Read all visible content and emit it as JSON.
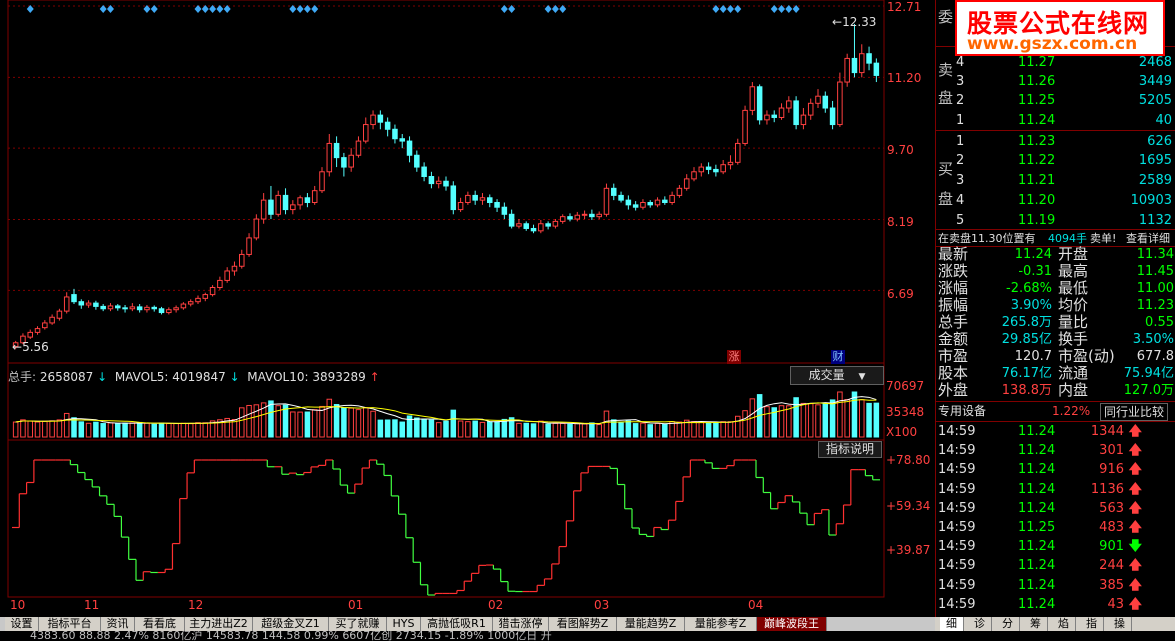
{
  "price_chart": {
    "y_ticks": [
      "12.71",
      "11.20",
      "9.70",
      "8.19",
      "6.69"
    ],
    "high_label": "12.33",
    "low_label": "5.56",
    "event_markers": [
      "涨",
      "财"
    ],
    "candles": [
      [
        5.5,
        5.58,
        5.45,
        5.62
      ],
      [
        5.58,
        5.72,
        5.55,
        5.78
      ],
      [
        5.7,
        5.8,
        5.66,
        5.86
      ],
      [
        5.8,
        5.88,
        5.75,
        5.93
      ],
      [
        5.9,
        6.0,
        5.86,
        6.06
      ],
      [
        6.0,
        6.12,
        5.96,
        6.18
      ],
      [
        6.1,
        6.25,
        6.05,
        6.3
      ],
      [
        6.25,
        6.55,
        6.2,
        6.65
      ],
      [
        6.6,
        6.45,
        6.4,
        6.72
      ],
      [
        6.45,
        6.38,
        6.3,
        6.5
      ],
      [
        6.38,
        6.42,
        6.32,
        6.48
      ],
      [
        6.42,
        6.35,
        6.28,
        6.47
      ],
      [
        6.35,
        6.3,
        6.25,
        6.4
      ],
      [
        6.3,
        6.36,
        6.25,
        6.42
      ],
      [
        6.36,
        6.32,
        6.26,
        6.4
      ],
      [
        6.32,
        6.3,
        6.22,
        6.38
      ],
      [
        6.3,
        6.34,
        6.25,
        6.42
      ],
      [
        6.34,
        6.28,
        6.22,
        6.4
      ],
      [
        6.28,
        6.33,
        6.22,
        6.38
      ],
      [
        6.33,
        6.3,
        6.24,
        6.37
      ],
      [
        6.3,
        6.22,
        6.18,
        6.34
      ],
      [
        6.22,
        6.28,
        6.18,
        6.33
      ],
      [
        6.28,
        6.32,
        6.22,
        6.37
      ],
      [
        6.32,
        6.4,
        6.28,
        6.44
      ],
      [
        6.4,
        6.45,
        6.35,
        6.5
      ],
      [
        6.45,
        6.52,
        6.4,
        6.58
      ],
      [
        6.52,
        6.6,
        6.46,
        6.64
      ],
      [
        6.6,
        6.75,
        6.56,
        6.8
      ],
      [
        6.75,
        6.9,
        6.7,
        6.98
      ],
      [
        6.9,
        7.1,
        6.85,
        7.18
      ],
      [
        7.1,
        7.2,
        7.0,
        7.3
      ],
      [
        7.2,
        7.45,
        7.15,
        7.55
      ],
      [
        7.45,
        7.8,
        7.4,
        7.9
      ],
      [
        7.8,
        8.2,
        7.75,
        8.3
      ],
      [
        8.2,
        8.6,
        8.1,
        8.75
      ],
      [
        8.6,
        8.3,
        8.2,
        8.9
      ],
      [
        8.3,
        8.7,
        8.25,
        8.8
      ],
      [
        8.7,
        8.4,
        8.3,
        8.85
      ],
      [
        8.4,
        8.5,
        8.3,
        8.6
      ],
      [
        8.5,
        8.65,
        8.4,
        8.7
      ],
      [
        8.65,
        8.55,
        8.45,
        8.75
      ],
      [
        8.55,
        8.8,
        8.5,
        8.9
      ],
      [
        8.8,
        9.2,
        8.75,
        9.3
      ],
      [
        9.2,
        9.8,
        9.1,
        10.0
      ],
      [
        9.8,
        9.5,
        9.3,
        9.95
      ],
      [
        9.5,
        9.3,
        9.1,
        9.6
      ],
      [
        9.3,
        9.55,
        9.2,
        9.7
      ],
      [
        9.55,
        9.85,
        9.5,
        9.95
      ],
      [
        9.85,
        10.2,
        9.8,
        10.35
      ],
      [
        10.2,
        10.4,
        10.1,
        10.5
      ],
      [
        10.4,
        10.25,
        10.1,
        10.5
      ],
      [
        10.25,
        10.1,
        9.95,
        10.35
      ],
      [
        10.1,
        9.9,
        9.8,
        10.2
      ],
      [
        9.9,
        9.85,
        9.7,
        10.0
      ],
      [
        9.85,
        9.55,
        9.4,
        9.95
      ],
      [
        9.55,
        9.3,
        9.2,
        9.65
      ],
      [
        9.3,
        9.1,
        9.0,
        9.4
      ],
      [
        9.1,
        8.95,
        8.85,
        9.2
      ],
      [
        8.95,
        9.0,
        8.85,
        9.1
      ],
      [
        9.0,
        8.9,
        8.8,
        9.1
      ],
      [
        8.9,
        8.4,
        8.3,
        9.0
      ],
      [
        8.4,
        8.55,
        8.35,
        8.65
      ],
      [
        8.55,
        8.7,
        8.5,
        8.78
      ],
      [
        8.7,
        8.6,
        8.5,
        8.8
      ],
      [
        8.6,
        8.65,
        8.5,
        8.75
      ],
      [
        8.65,
        8.55,
        8.45,
        8.72
      ],
      [
        8.55,
        8.45,
        8.35,
        8.62
      ],
      [
        8.45,
        8.3,
        8.2,
        8.55
      ],
      [
        8.3,
        8.05,
        8.0,
        8.4
      ],
      [
        8.05,
        8.1,
        8.0,
        8.2
      ],
      [
        8.1,
        8.0,
        7.95,
        8.15
      ],
      [
        8.0,
        7.95,
        7.9,
        8.08
      ],
      [
        7.95,
        8.1,
        7.9,
        8.18
      ],
      [
        8.1,
        8.05,
        7.98,
        8.15
      ],
      [
        8.05,
        8.15,
        8.0,
        8.2
      ],
      [
        8.15,
        8.25,
        8.1,
        8.3
      ],
      [
        8.25,
        8.2,
        8.15,
        8.32
      ],
      [
        8.2,
        8.28,
        8.15,
        8.35
      ],
      [
        8.28,
        8.3,
        8.2,
        8.38
      ],
      [
        8.3,
        8.25,
        8.18,
        8.4
      ],
      [
        8.25,
        8.3,
        8.2,
        8.36
      ],
      [
        8.3,
        8.85,
        8.25,
        8.95
      ],
      [
        8.85,
        8.7,
        8.6,
        8.95
      ],
      [
        8.7,
        8.6,
        8.55,
        8.78
      ],
      [
        8.6,
        8.5,
        8.4,
        8.7
      ],
      [
        8.5,
        8.45,
        8.38,
        8.58
      ],
      [
        8.45,
        8.55,
        8.4,
        8.62
      ],
      [
        8.55,
        8.5,
        8.44,
        8.6
      ],
      [
        8.5,
        8.6,
        8.45,
        8.66
      ],
      [
        8.6,
        8.55,
        8.5,
        8.68
      ],
      [
        8.55,
        8.7,
        8.5,
        8.78
      ],
      [
        8.7,
        8.85,
        8.65,
        8.92
      ],
      [
        8.85,
        9.05,
        8.8,
        9.15
      ],
      [
        9.05,
        9.2,
        9.0,
        9.3
      ],
      [
        9.2,
        9.3,
        9.1,
        9.38
      ],
      [
        9.3,
        9.25,
        9.15,
        9.4
      ],
      [
        9.25,
        9.2,
        9.1,
        9.35
      ],
      [
        9.2,
        9.35,
        9.15,
        9.45
      ],
      [
        9.35,
        9.4,
        9.25,
        9.55
      ],
      [
        9.4,
        9.8,
        9.35,
        9.9
      ],
      [
        9.8,
        10.5,
        9.75,
        10.6
      ],
      [
        10.5,
        11.0,
        10.4,
        11.1
      ],
      [
        11.0,
        10.3,
        10.2,
        11.05
      ],
      [
        10.3,
        10.4,
        10.2,
        10.5
      ],
      [
        10.4,
        10.35,
        10.25,
        10.5
      ],
      [
        10.35,
        10.55,
        10.3,
        10.65
      ],
      [
        10.55,
        10.7,
        10.45,
        10.8
      ],
      [
        10.7,
        10.2,
        10.1,
        10.8
      ],
      [
        10.2,
        10.4,
        10.1,
        10.55
      ],
      [
        10.4,
        10.65,
        10.3,
        10.75
      ],
      [
        10.65,
        10.8,
        10.55,
        10.95
      ],
      [
        10.8,
        10.55,
        10.45,
        10.9
      ],
      [
        10.55,
        10.2,
        10.1,
        10.7
      ],
      [
        10.2,
        11.1,
        10.15,
        11.3
      ],
      [
        11.1,
        11.6,
        11.0,
        11.7
      ],
      [
        11.6,
        11.3,
        11.2,
        12.33
      ],
      [
        11.3,
        11.7,
        11.2,
        11.9
      ],
      [
        11.7,
        11.5,
        11.35,
        11.85
      ],
      [
        11.5,
        11.24,
        11.1,
        11.6
      ]
    ]
  },
  "volume_chart": {
    "summary": [
      {
        "label": "总手:",
        "value": "2658087",
        "dir": "down"
      },
      {
        "label": "MAVOL5:",
        "value": "4019847",
        "dir": "down"
      },
      {
        "label": "MAVOL10:",
        "value": "3893289",
        "dir": "up"
      }
    ],
    "dropdown_label": "成交量",
    "y_ticks": [
      "70697",
      "35348",
      "X100"
    ]
  },
  "indicator_chart": {
    "y_ticks": [
      "+78.80",
      "+59.34",
      "+39.87"
    ],
    "button_label": "指标说明"
  },
  "x_axis": {
    "labels": [
      {
        "text": "10",
        "index": 0
      },
      {
        "text": "11",
        "index": 12
      },
      {
        "text": "12",
        "index": 27
      },
      {
        "text": "01",
        "index": 50
      },
      {
        "text": "02",
        "index": 70
      },
      {
        "text": "03",
        "index": 86
      },
      {
        "text": "04",
        "index": 108
      }
    ]
  },
  "order_book": {
    "top_label": "委",
    "sell_label": [
      "卖",
      "盘"
    ],
    "buy_label": [
      "买",
      "盘"
    ],
    "sell": [
      {
        "level": "4",
        "price": "11.27",
        "vol": "2468"
      },
      {
        "level": "3",
        "price": "11.26",
        "vol": "3449"
      },
      {
        "level": "2",
        "price": "11.25",
        "vol": "5205"
      },
      {
        "level": "1",
        "price": "11.24",
        "vol": "40"
      }
    ],
    "buy": [
      {
        "level": "1",
        "price": "11.23",
        "vol": "626"
      },
      {
        "level": "2",
        "price": "11.22",
        "vol": "1695"
      },
      {
        "level": "3",
        "price": "11.21",
        "vol": "2589"
      },
      {
        "level": "4",
        "price": "11.20",
        "vol": "10903"
      },
      {
        "level": "5",
        "price": "11.19",
        "vol": "1132"
      }
    ],
    "notice": {
      "text": "在卖盘11.30位置有",
      "qty": "4094手",
      "action": "卖单!",
      "link": "查看详细"
    }
  },
  "quote": [
    {
      "l1": "最新",
      "v1": "11.24",
      "c1": "green",
      "l2": "开盘",
      "v2": "11.34",
      "c2": "green"
    },
    {
      "l1": "涨跌",
      "v1": "-0.31",
      "c1": "green",
      "l2": "最高",
      "v2": "11.45",
      "c2": "green"
    },
    {
      "l1": "涨幅",
      "v1": "-2.68%",
      "c1": "green",
      "l2": "最低",
      "v2": "11.00",
      "c2": "green"
    },
    {
      "l1": "振幅",
      "v1": "3.90%",
      "c1": "cyan",
      "l2": "均价",
      "v2": "11.23",
      "c2": "green"
    },
    {
      "l1": "总手",
      "v1": "265.8万",
      "c1": "cyan",
      "l2": "量比",
      "v2": "0.55",
      "c2": "green"
    },
    {
      "l1": "金额",
      "v1": "29.85亿",
      "c1": "cyan",
      "l2": "换手",
      "v2": "3.50%",
      "c2": "cyan"
    },
    {
      "l1": "市盈",
      "v1": "120.7",
      "c1": "white",
      "l2": "市盈(动)",
      "v2": "677.8",
      "c2": "white"
    },
    {
      "l1": "股本",
      "v1": "76.17亿",
      "c1": "cyan",
      "l2": "流通",
      "v2": "75.94亿",
      "c2": "cyan"
    },
    {
      "l1": "外盘",
      "v1": "138.8万",
      "c1": "red",
      "l2": "内盘",
      "v2": "127.0万",
      "c2": "green"
    }
  ],
  "sector": {
    "name": "专用设备",
    "change": "1.22%",
    "compare_button": "同行业比较"
  },
  "ticks": [
    {
      "time": "14:59",
      "price": "11.24",
      "vol": "1344",
      "dir": "up"
    },
    {
      "time": "14:59",
      "price": "11.24",
      "vol": "301",
      "dir": "up"
    },
    {
      "time": "14:59",
      "price": "11.24",
      "vol": "916",
      "dir": "up"
    },
    {
      "time": "14:59",
      "price": "11.24",
      "vol": "1136",
      "dir": "up"
    },
    {
      "time": "14:59",
      "price": "11.24",
      "vol": "563",
      "dir": "up"
    },
    {
      "time": "14:59",
      "price": "11.25",
      "vol": "483",
      "dir": "up"
    },
    {
      "time": "14:59",
      "price": "11.24",
      "vol": "901",
      "dir": "down"
    },
    {
      "time": "14:59",
      "price": "11.24",
      "vol": "244",
      "dir": "up"
    },
    {
      "time": "14:59",
      "price": "11.24",
      "vol": "385",
      "dir": "up"
    },
    {
      "time": "14:59",
      "price": "11.24",
      "vol": "43",
      "dir": "up"
    }
  ],
  "tabs": [
    "设置",
    "指标平台",
    "资讯",
    "看看底",
    "主力进出Z2",
    "超级金叉Z1",
    "买了就赚",
    "HYS",
    "高抛低吸R1",
    "猎击涨停",
    "看图解势Z",
    "量能趋势Z",
    "量能参考Z",
    "巅峰波段王"
  ],
  "active_tab": "巅峰波段王",
  "right_tabs": [
    "细",
    "诊",
    "分",
    "筹",
    "焰",
    "指",
    "操"
  ],
  "watermark": {
    "title": "股票公式在线网",
    "url": "www.gszx.com.cn"
  },
  "status_text": "4383.60   88.88   2.47%   8160亿沪   14583.78   144.58   0.99%   6607亿创   2734.15   -1.89%   1000亿日 开"
}
